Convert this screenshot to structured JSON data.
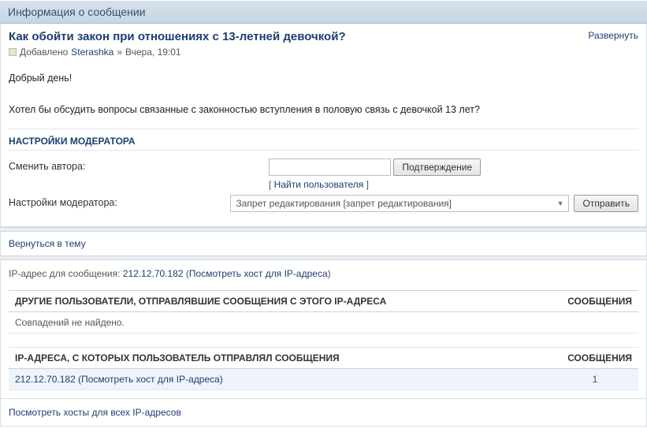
{
  "page_title": "Информация о сообщении",
  "expand_label": "Развернуть",
  "thread": {
    "title": "Как обойти закон при отношениях с 13-летней девочкой?",
    "posted_prefix": "Добавлено",
    "author": "Sterashka",
    "timestamp_sep": " » ",
    "timestamp": "Вчера, 19:01",
    "greeting": "Добрый день!",
    "body": "Хотел бы обсудить вопросы связанные с законностью вступления в половую связь с девочкой 13 лет?"
  },
  "mod": {
    "heading": "НАСТРОЙКИ МОДЕРАТОРА",
    "change_author_label": "Сменить автора:",
    "confirm_button": "Подтверждение",
    "find_user": "Найти пользователя",
    "settings_label": "Настройки модератора:",
    "select_value": "Запрет редактирования [запрет редактирования]",
    "submit_button": "Отправить"
  },
  "return_link": "Вернуться в тему",
  "ip": {
    "line_prefix": "IP-адрес для сообщения: ",
    "address": "212.12.70.182",
    "host_link": "Посмотреть хост для IP-адреса",
    "table1_header": "ДРУГИЕ ПОЛЬЗОВАТЕЛИ, ОТПРАВЛЯВШИЕ СООБЩЕНИЯ С ЭТОГО IP-АДРЕСА",
    "col_messages": "СООБЩЕНИЯ",
    "no_matches": "Совпадений не найдено.",
    "table2_header": "IP-АДРЕСА, С КОТОРЫХ ПОЛЬЗОВАТЕЛЬ ОТПРАВЛЯЛ СООБЩЕНИЯ",
    "row_ip_text": "212.12.70.182 (Посмотреть хост для IP-адреса)",
    "row_count": "1",
    "all_hosts_link": "Посмотреть хосты для всех IP-адресов"
  }
}
